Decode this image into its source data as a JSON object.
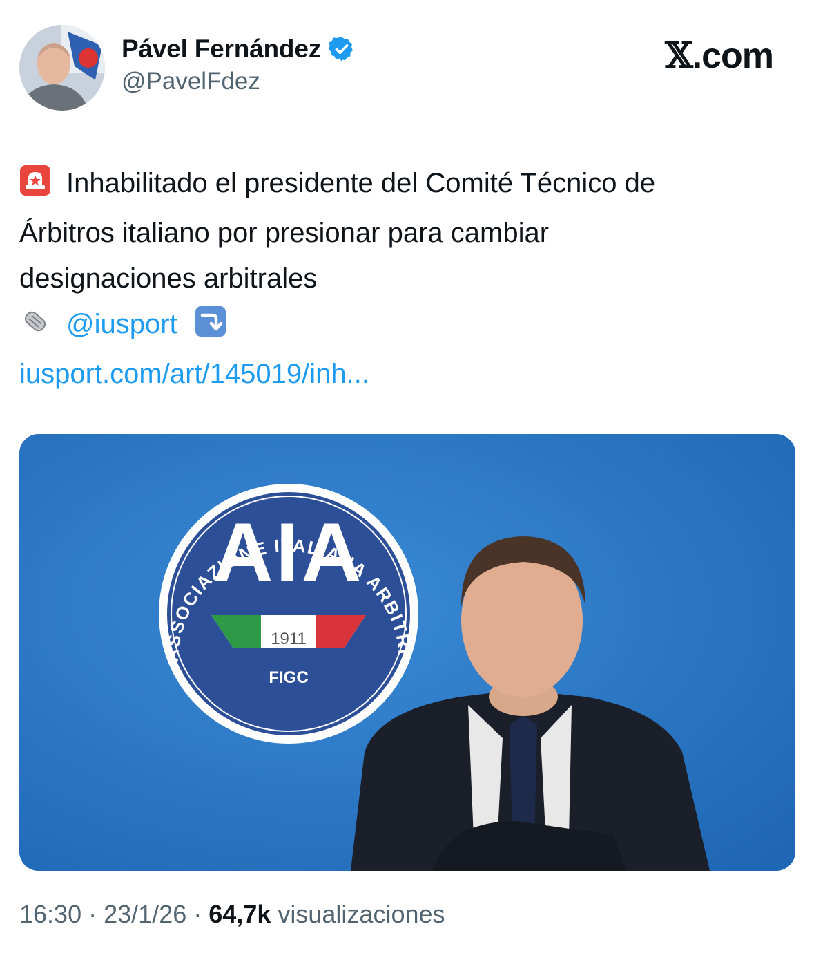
{
  "tweet": {
    "author_name": "Pável Fernández",
    "author_handle": "@PavelFdez",
    "verified_color": "#1d9bf0",
    "site": "X.com",
    "site_x": "𝕏",
    "site_suffix": ".com",
    "emoji_alert": "siren-icon",
    "text_line1": "Inhabilitado el presidente del Comité Técnico de",
    "text_line2": "Árbitros italiano por presionar para cambiar",
    "text_line3": "designaciones arbitrales",
    "emoji_news": "newspaper-icon",
    "mention": "@iusport",
    "emoji_arrow": "arrow-down-icon",
    "link": "iusport.com/art/145019/inh...",
    "time": "16:30",
    "date": "23/1/26",
    "views_count": "64,7k",
    "views_label": "visualizaciones",
    "separator": "·"
  },
  "media": {
    "logo_text_arc": "ASSOCIAZIONE ITALIANA ARBITRI",
    "logo_letters": "AIA",
    "logo_year": "1911",
    "logo_bottom": "FIGC",
    "background_color": "#2a7bc8"
  }
}
